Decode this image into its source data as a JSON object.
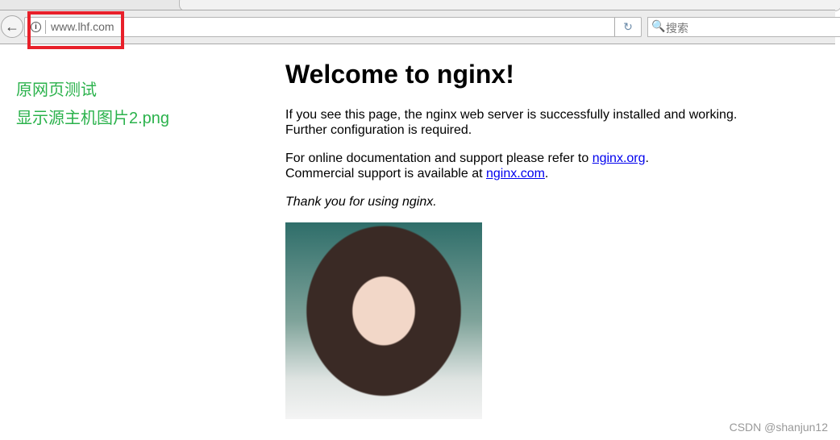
{
  "browser": {
    "url_prefix": "www.",
    "url_host": "lhf.com",
    "url_suffix": ".com",
    "url": "www.lhf.com",
    "search_placeholder": "搜索",
    "back_icon": "←",
    "reload_icon": "↻",
    "search_icon": "🔍"
  },
  "sidebar": {
    "links": [
      {
        "label": "原网页测试"
      },
      {
        "label": "显示源主机图片2.png"
      }
    ]
  },
  "main": {
    "title": "Welcome to nginx!",
    "p1": "If you see this page, the nginx web server is successfully installed and working. Further configuration is required.",
    "p2a": "For online documentation and support please refer to ",
    "link1": "nginx.org",
    "p2b": ".",
    "p2c": "Commercial support is available at ",
    "link2": "nginx.com",
    "p2d": ".",
    "p3": "Thank you for using nginx."
  },
  "watermark": "CSDN @shanjun12",
  "colors": {
    "highlight": "#e8202a",
    "link_green": "#2bb24c"
  }
}
